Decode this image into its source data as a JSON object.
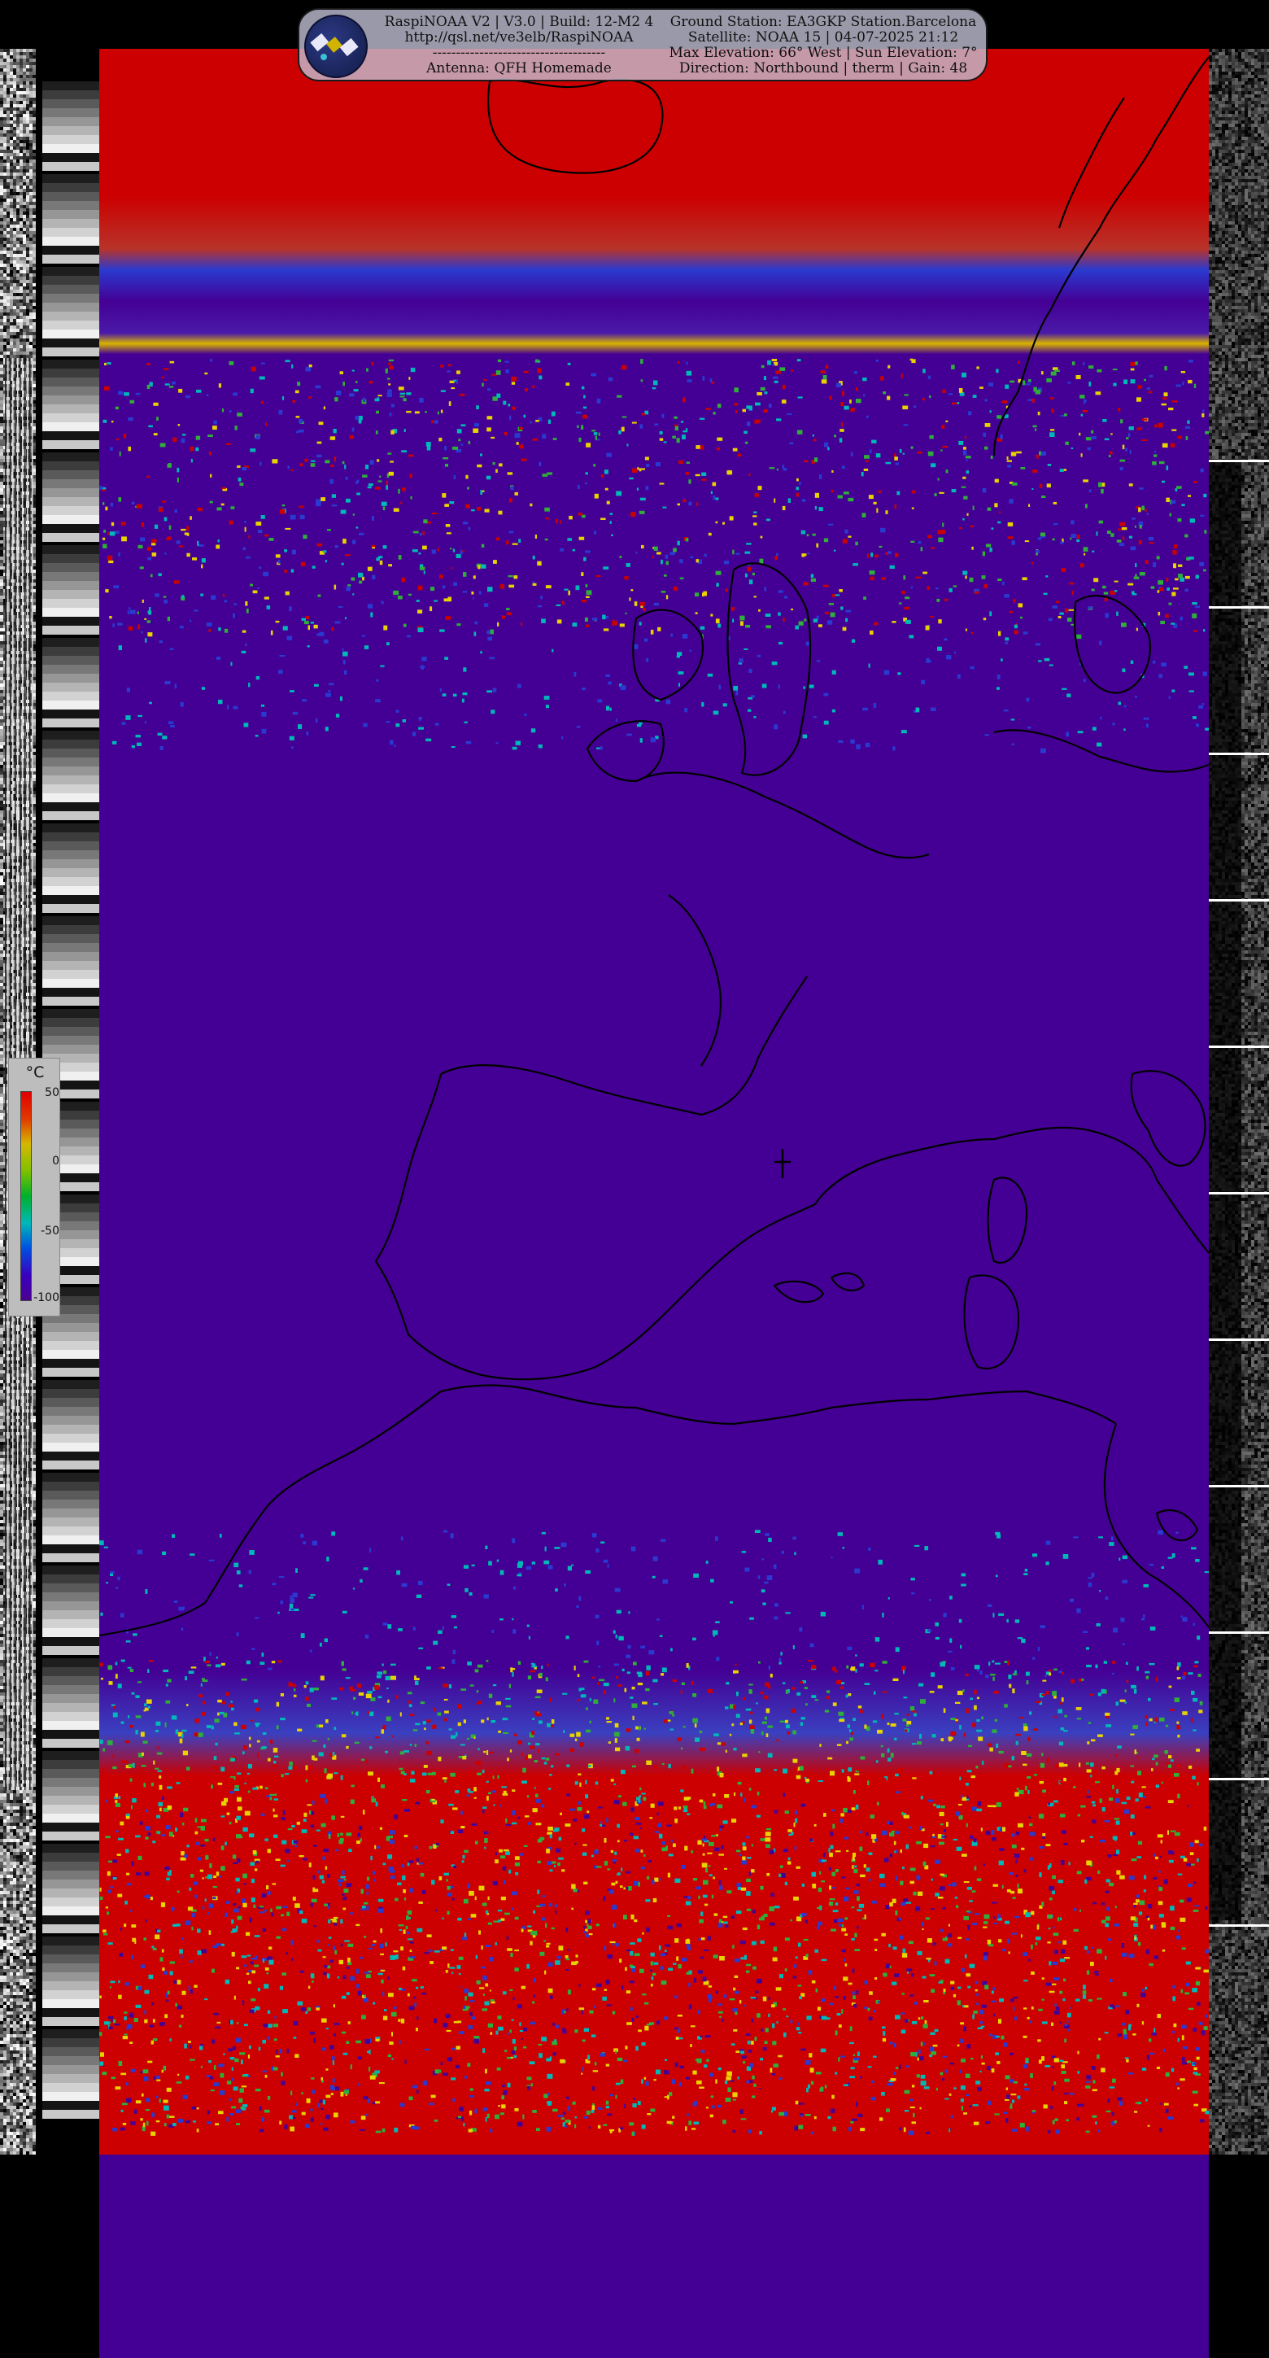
{
  "image": {
    "subject": "NOAA APT thermal satellite image",
    "palette": {
      "warm": "#cc0000",
      "cold": "#440094",
      "mid_green": "#2fae3a",
      "mid_yellow": "#e8d200",
      "mid_blue": "#2a3ad0",
      "coast": "#000000"
    }
  },
  "header": {
    "logo_icon": "satellite-icon",
    "left_lines": [
      "RaspiNOAA V2 | V3.0 | Build: 12-M2 4",
      "http://qsl.net/ve3elb/RaspiNOAA",
      "-------------------------------------",
      "Antenna: QFH Homemade"
    ],
    "right_lines": [
      "Ground Station: EA3GKP Station.Barcelona",
      "Satellite: NOAA 15 | 04-07-2025 21:12",
      "Max Elevation: 66° West | Sun Elevation: 7°",
      "Direction: Northbound | therm | Gain: 48"
    ]
  },
  "legend": {
    "unit": "°C",
    "ticks": [
      "50",
      "0",
      "-50",
      "-100"
    ],
    "gradient": [
      "#e00000",
      "#e03a00",
      "#d6b800",
      "#7ec000",
      "#00b02a",
      "#00b8b8",
      "#0050e0",
      "#3a00c0",
      "#4a0090"
    ]
  }
}
